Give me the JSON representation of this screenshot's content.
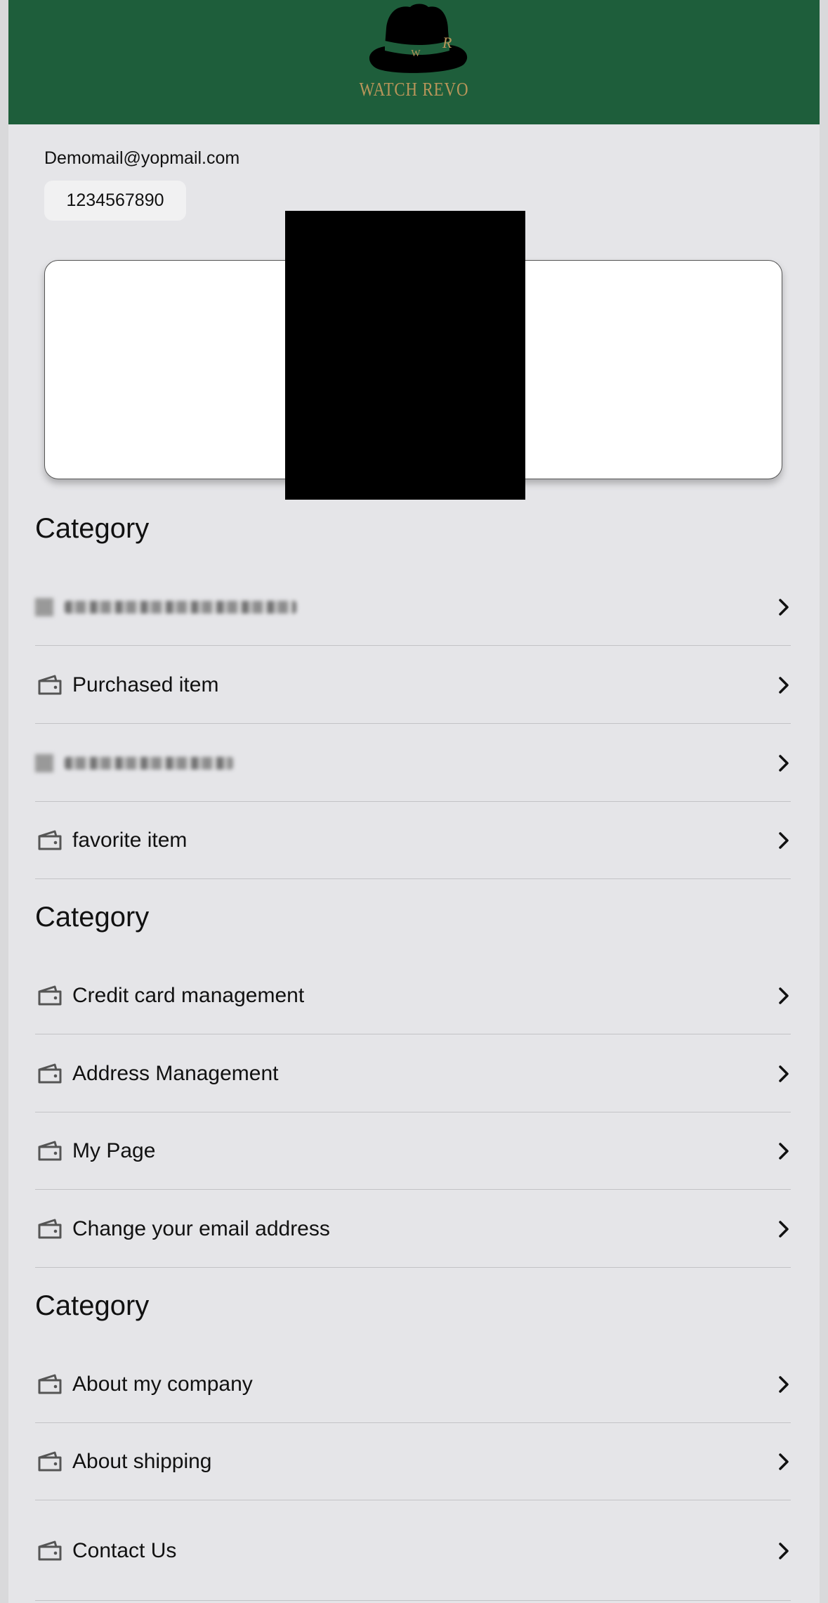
{
  "header": {
    "brand_text": "WATCH REVO",
    "logo_initials_left": "W",
    "logo_initials_right": "R",
    "bg_color": "#1e5e3b",
    "brand_color": "#b8955a"
  },
  "profile": {
    "email": "Demomail@yopmail.com",
    "phone": "1234567890"
  },
  "sections": [
    {
      "title": "Category",
      "items": [
        {
          "label": "",
          "icon": "wallet-icon",
          "blurred": true
        },
        {
          "label": "Purchased item",
          "icon": "wallet-icon"
        },
        {
          "label": "",
          "icon": "wallet-icon",
          "blurred": true
        },
        {
          "label": "favorite item",
          "icon": "wallet-icon"
        }
      ]
    },
    {
      "title": "Category",
      "items": [
        {
          "label": "Credit card management",
          "icon": "wallet-icon"
        },
        {
          "label": "Address Management",
          "icon": "wallet-icon"
        },
        {
          "label": "My Page",
          "icon": "wallet-icon"
        },
        {
          "label": "Change your email address",
          "icon": "wallet-icon"
        }
      ]
    },
    {
      "title": "Category",
      "items": [
        {
          "label": "About my company",
          "icon": "wallet-icon"
        },
        {
          "label": "About shipping",
          "icon": "wallet-icon"
        },
        {
          "label": "Contact Us",
          "icon": "wallet-icon"
        }
      ]
    }
  ]
}
